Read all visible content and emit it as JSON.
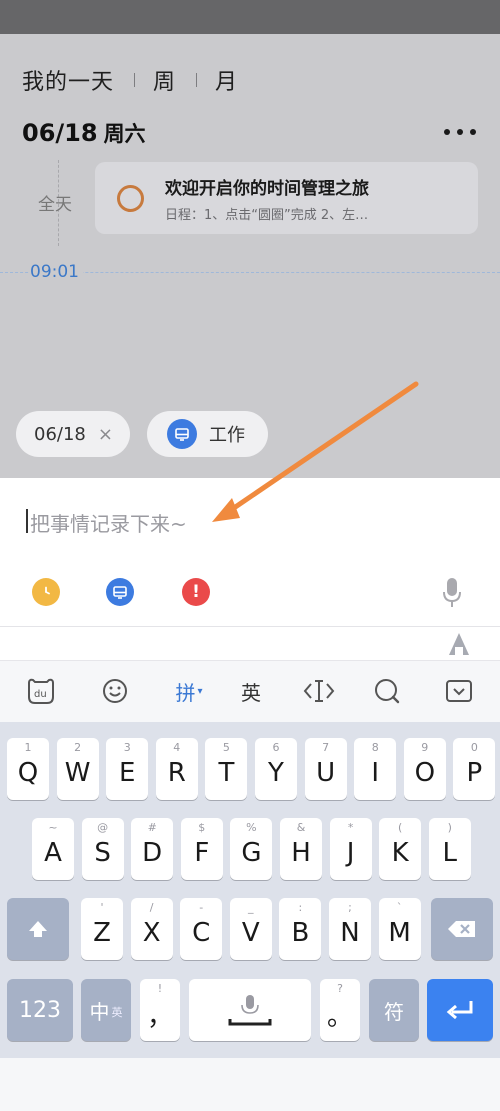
{
  "calendar": {
    "view_tabs": [
      "我的一天",
      "周",
      "月"
    ],
    "date": "06/18",
    "weekday": "周六",
    "allday_label": "全天",
    "event": {
      "title": "欢迎开启你的时间管理之旅",
      "desc": "日程：1、点击“圆圈”完成 2、左…"
    },
    "current_time": "09:01"
  },
  "chips": {
    "date": "06/18",
    "date_remove": "×",
    "category": "工作"
  },
  "input": {
    "placeholder": "把事情记录下来~"
  },
  "candidate_bar": {
    "pinyin": "拼",
    "english": "英"
  },
  "keyboard": {
    "row1": [
      {
        "main": "Q",
        "sub": "1"
      },
      {
        "main": "W",
        "sub": "2"
      },
      {
        "main": "E",
        "sub": "3"
      },
      {
        "main": "R",
        "sub": "4"
      },
      {
        "main": "T",
        "sub": "5"
      },
      {
        "main": "Y",
        "sub": "6"
      },
      {
        "main": "U",
        "sub": "7"
      },
      {
        "main": "I",
        "sub": "8"
      },
      {
        "main": "O",
        "sub": "9"
      },
      {
        "main": "P",
        "sub": "0"
      }
    ],
    "row2": [
      {
        "main": "A",
        "sub": "~"
      },
      {
        "main": "S",
        "sub": "@"
      },
      {
        "main": "D",
        "sub": "#"
      },
      {
        "main": "F",
        "sub": "$"
      },
      {
        "main": "G",
        "sub": "%"
      },
      {
        "main": "H",
        "sub": "&"
      },
      {
        "main": "J",
        "sub": "*"
      },
      {
        "main": "K",
        "sub": "("
      },
      {
        "main": "L",
        "sub": ")"
      }
    ],
    "row3": [
      {
        "main": "Z",
        "sub": "'"
      },
      {
        "main": "X",
        "sub": "/"
      },
      {
        "main": "C",
        "sub": "-"
      },
      {
        "main": "V",
        "sub": "_"
      },
      {
        "main": "B",
        "sub": ":"
      },
      {
        "main": "N",
        "sub": ";"
      },
      {
        "main": "M",
        "sub": "`"
      }
    ],
    "num_key": "123",
    "lang_key": "中",
    "lang_key_sub": "英",
    "comma_key": "，",
    "comma_sub": "!",
    "period_key": "。",
    "period_sub": "?",
    "symbol_key": "符"
  },
  "colors": {
    "accent": "#3b82f0",
    "clock": "#f2b844",
    "tag": "#3d7be0",
    "priority": "#ea4a4a",
    "arrow": "#f08a3e",
    "event_circle": "#c77a3e"
  }
}
